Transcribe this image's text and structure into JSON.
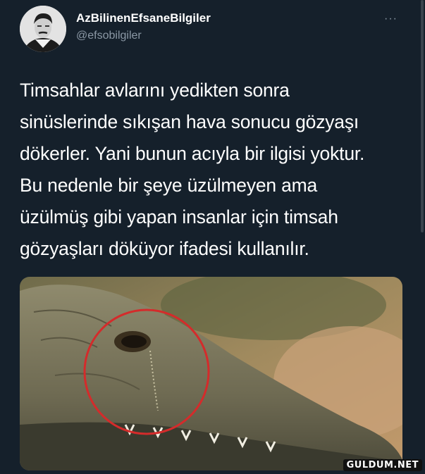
{
  "user": {
    "display_name": "AzBilinenEfsaneBilgiler",
    "handle": "@efsobilgiler",
    "avatar_icon": "portrait-avatar"
  },
  "more_label": "···",
  "tweet": {
    "text": "Timsahlar avlarını yedikten sonra\nsinüslerinde sıkışan hava sonucu gözyaşı\ndökerler. Yani bunun acıyla bir ilgisi yoktur.\nBu nedenle bir şeye üzülmeyen ama\nüzülmüş gibi yapan insanlar için timsah\ngözyaşları döküyor ifadesi kullanılır."
  },
  "media": {
    "subject": "crocodile-photo",
    "highlight_color": "#d42b2b"
  },
  "watermark": "GULDUM.NET",
  "colors": {
    "background": "#15202b",
    "secondary_text": "#8b98a5"
  }
}
